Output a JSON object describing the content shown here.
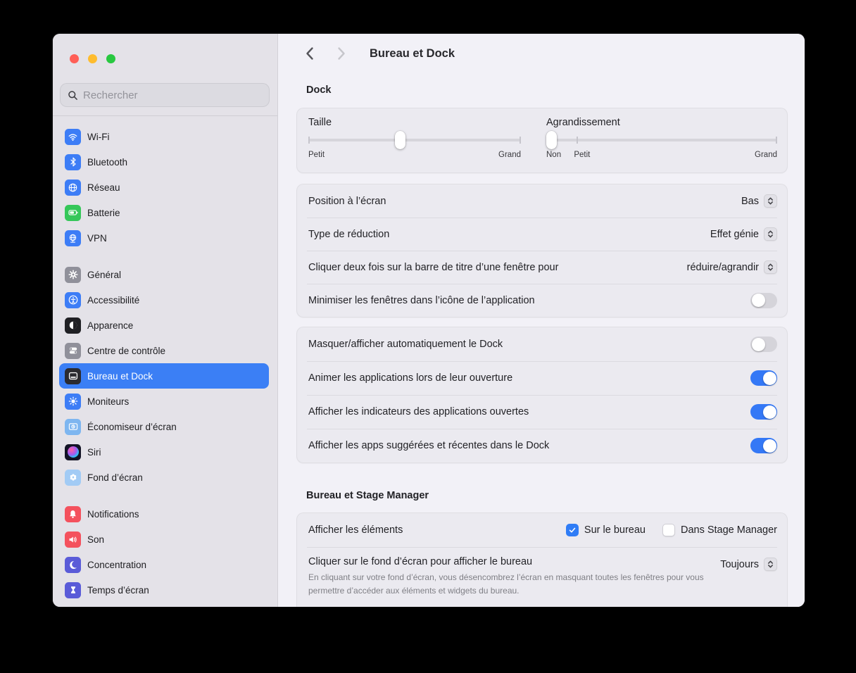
{
  "window": {
    "title": "Bureau et Dock"
  },
  "colors": {
    "accent_blue": "#3478f6",
    "sidebar_selected": "#3b7ff5",
    "toggle_on": "#3478f6",
    "checkbox_checked": "#2f7cf6",
    "battery_green": "#35c759",
    "notification_red": "#f4515d",
    "focus_indigo": "#5a5bd8"
  },
  "sidebar": {
    "search_placeholder": "Rechercher",
    "groups": [
      {
        "items": [
          {
            "label": "Wi-Fi",
            "icon": "wifi-icon"
          },
          {
            "label": "Bluetooth",
            "icon": "bluetooth-icon"
          },
          {
            "label": "Réseau",
            "icon": "globe-icon"
          },
          {
            "label": "Batterie",
            "icon": "battery-icon"
          },
          {
            "label": "VPN",
            "icon": "vpn-globe-icon"
          }
        ]
      },
      {
        "items": [
          {
            "label": "Général",
            "icon": "gear-icon"
          },
          {
            "label": "Accessibilité",
            "icon": "accessibility-icon"
          },
          {
            "label": "Apparence",
            "icon": "appearance-icon"
          },
          {
            "label": "Centre de contrôle",
            "icon": "control-center-icon"
          },
          {
            "label": "Bureau et Dock",
            "icon": "desktop-dock-icon",
            "selected": true
          },
          {
            "label": "Moniteurs",
            "icon": "displays-sun-icon"
          },
          {
            "label": "Économiseur d’écran",
            "icon": "screensaver-icon"
          },
          {
            "label": "Siri",
            "icon": "siri-icon"
          },
          {
            "label": "Fond d’écran",
            "icon": "wallpaper-flower-icon"
          }
        ]
      },
      {
        "items": [
          {
            "label": "Notifications",
            "icon": "bell-icon"
          },
          {
            "label": "Son",
            "icon": "speaker-icon"
          },
          {
            "label": "Concentration",
            "icon": "moon-icon"
          },
          {
            "label": "Temps d’écran",
            "icon": "hourglass-icon"
          }
        ]
      }
    ]
  },
  "content": {
    "title": "Bureau et Dock",
    "dock_section_title": "Dock",
    "sliders": {
      "taille": {
        "label": "Taille",
        "min_label": "Petit",
        "max_label": "Grand",
        "value_percent": 43
      },
      "agrandissement": {
        "label": "Agrandissement",
        "off_label": "Non",
        "min_label": "Petit",
        "max_label": "Grand",
        "value_percent": 0,
        "tick_percent": 13
      }
    },
    "appearance_card": {
      "rows": [
        {
          "label": "Position à l’écran",
          "control": "select",
          "value": "Bas"
        },
        {
          "label": "Type de réduction",
          "control": "select",
          "value": "Effet génie"
        },
        {
          "label": "Cliquer deux fois sur la barre de titre d’une fenêtre pour",
          "control": "select",
          "value": "réduire/agrandir"
        },
        {
          "label": "Minimiser les fenêtres dans l’icône de l’application",
          "control": "toggle",
          "value": false
        }
      ]
    },
    "behavior_card": {
      "rows": [
        {
          "label": "Masquer/afficher automatiquement le Dock",
          "control": "toggle",
          "value": false
        },
        {
          "label": "Animer les applications lors de leur ouverture",
          "control": "toggle",
          "value": true
        },
        {
          "label": "Afficher les indicateurs des applications ouvertes",
          "control": "toggle",
          "value": true
        },
        {
          "label": "Afficher les apps suggérées et récentes dans le Dock",
          "control": "toggle",
          "value": true
        }
      ]
    },
    "stage_section_title": "Bureau et Stage Manager",
    "stage_card": {
      "row1": {
        "label": "Afficher les éléments",
        "checkboxes": [
          {
            "label": "Sur le bureau",
            "checked": true
          },
          {
            "label": "Dans Stage Manager",
            "checked": false
          }
        ]
      },
      "row2": {
        "label": "Cliquer sur le fond d’écran pour afficher le bureau",
        "value": "Toujours",
        "description": "En cliquant sur votre fond d’écran, vous désencombrez l’écran en masquant toutes les fenêtres pour vous permettre d’accéder aux éléments et widgets du bureau."
      }
    }
  }
}
